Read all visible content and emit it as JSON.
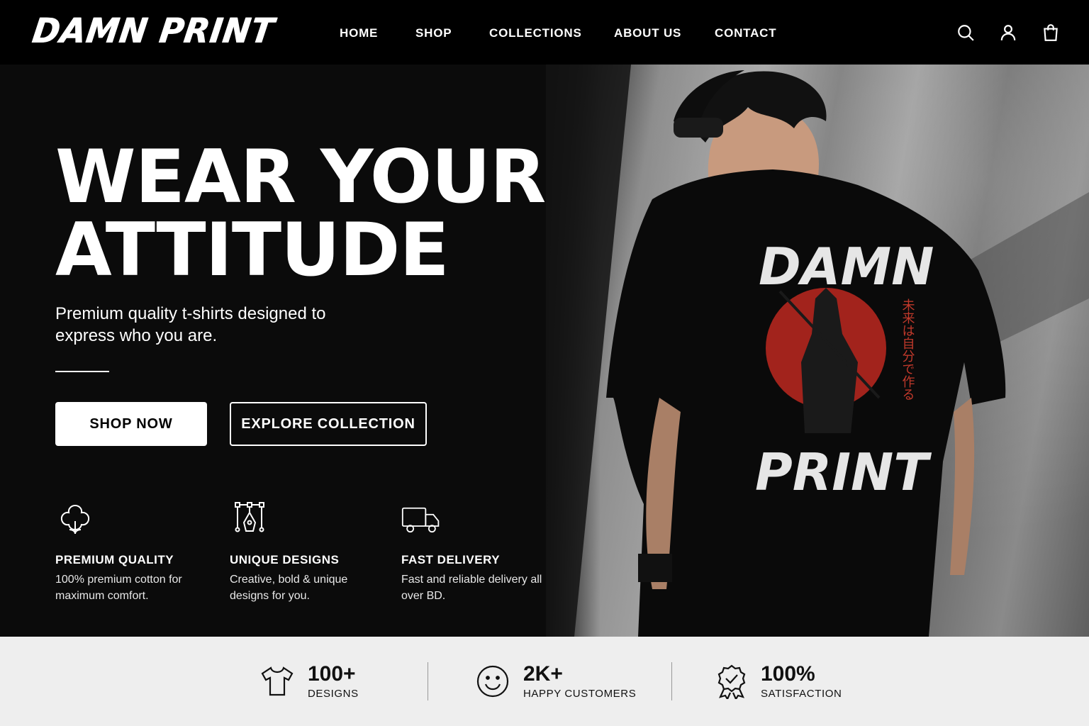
{
  "brand": {
    "logo_text": "DAMN PRINT"
  },
  "nav": {
    "items": [
      "HOME",
      "SHOP",
      "COLLECTIONS",
      "ABOUT US",
      "CONTACT"
    ],
    "icons": [
      "search-icon",
      "user-icon",
      "shopping-bag-icon"
    ]
  },
  "hero": {
    "headline_line1": "WEAR YOUR",
    "headline_line2": "ATTITUDE",
    "subheadline": "Premium quality t-shirts designed to express who you are.",
    "primary_button": "SHOP NOW",
    "secondary_button": "EXPLORE COLLECTION",
    "shirt_print_top": "DAMN",
    "shirt_print_bottom": "PRINT",
    "shirt_print_vertical": "未来は自分で作る"
  },
  "features": [
    {
      "icon": "cotton-icon",
      "title": "PREMIUM QUALITY",
      "description": "100% premium cotton for maximum comfort."
    },
    {
      "icon": "pen-tool-icon",
      "title": "UNIQUE DESIGNS",
      "description": "Creative, bold & unique designs for you."
    },
    {
      "icon": "truck-icon",
      "title": "FAST DELIVERY",
      "description": "Fast and reliable delivery all over BD."
    }
  ],
  "stats": [
    {
      "icon": "tshirt-icon",
      "value": "100+",
      "label": "DESIGNS"
    },
    {
      "icon": "smiley-icon",
      "value": "2K+",
      "label": "HAPPY CUSTOMERS"
    },
    {
      "icon": "award-badge-icon",
      "value": "100%",
      "label": "SATISFACTION"
    }
  ],
  "colors": {
    "background": "#0b0b0b",
    "accent_red": "#b3261e",
    "stats_bar": "#eeeeee",
    "text": "#ffffff"
  }
}
